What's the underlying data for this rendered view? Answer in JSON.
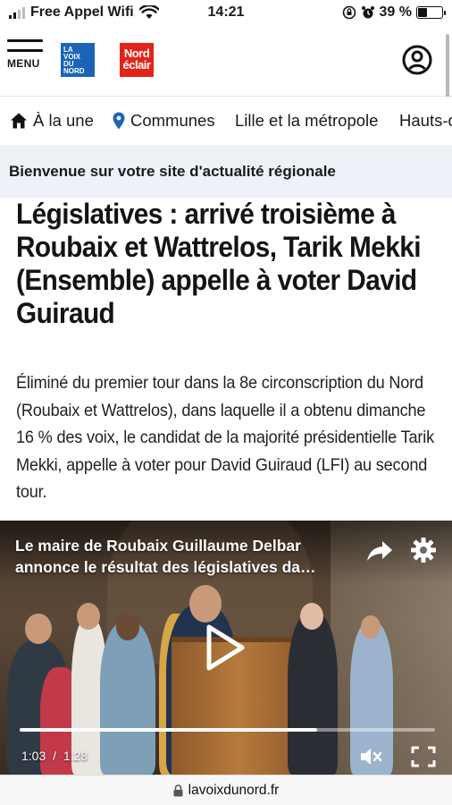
{
  "status_bar": {
    "carrier": "Free Appel Wifi",
    "time": "14:21",
    "battery_percent": "39 %",
    "battery_level": 0.39
  },
  "header": {
    "menu_label": "MENU",
    "logo_primary": "La Voix du Nord",
    "logo_secondary": "Nord éclair"
  },
  "nav": {
    "items": [
      {
        "label": "À la une",
        "icon": "home-icon"
      },
      {
        "label": "Communes",
        "icon": "location-pin-icon"
      },
      {
        "label": "Lille et la métropole",
        "icon": ""
      },
      {
        "label": "Hauts-d",
        "icon": ""
      }
    ]
  },
  "banner": {
    "text": "Bienvenue sur votre site d'actualité régionale"
  },
  "article": {
    "title": "Législatives : arrivé troisième à Roubaix et Wattrelos, Tarik Mekki (Ensemble) appelle à voter David Guiraud",
    "lede": "Éliminé du premier tour dans la 8e circonscription du Nord (Roubaix et Wattrelos), dans laquelle il a obtenu dimanche 16 % des voix, le candidat de la majorité présidentielle Tarik Mekki, appelle à voter pour David Guiraud (LFI) au second tour."
  },
  "video": {
    "title": "Le maire de Roubaix Guillaume Delbar annonce le résultat des législatives da…",
    "current_time": "1:03",
    "separator": "/",
    "duration": "1:28",
    "progress": 0.716
  },
  "url_bar": {
    "domain": "lavoixdunord.fr"
  },
  "colors": {
    "brand_blue": "#1b64b7",
    "brand_red": "#e2231a",
    "nav_pin_blue": "#1b64b7",
    "banner_bg": "#eef1f7"
  }
}
